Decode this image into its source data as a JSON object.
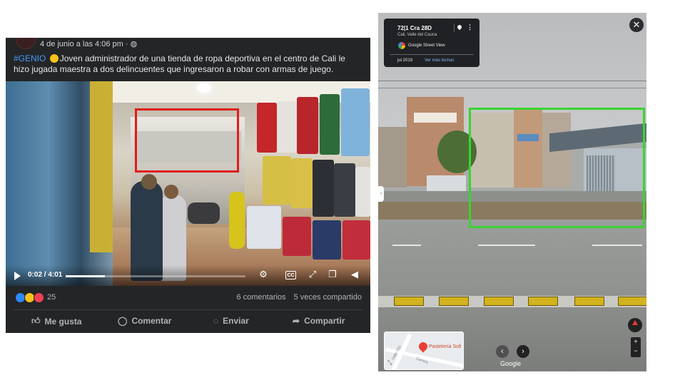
{
  "facebook_post": {
    "date": "4 de junio a las 4:06 pm · ",
    "hashtag": "#GENIO",
    "caption": "Joven administrador de una tienda de ropa deportiva en el centro de Cali le hizo jugada maestra a dos delincuentes que ingresaron a robar con armas de juego.",
    "video": {
      "time": "0:02 / 4:01",
      "progress": 0.22,
      "cc_label": "CC"
    },
    "reaction_count": "25",
    "comments": "6 comentarios",
    "shares": "5 veces compartido",
    "actions": {
      "like": "Me gusta",
      "comment": "Comentar",
      "send": "Enviar",
      "share": "Compartir"
    },
    "highlight_color": "#e11b1b"
  },
  "street_view": {
    "address": "72|1 Cra 28D",
    "city": "Cali, Valle del Cauca",
    "provider": "Google Street View",
    "date": "jul 2019",
    "more_dates": "Ver más fechas",
    "minimap": {
      "place": "Pastelería Sofi",
      "street1": "Calle 72D",
      "street2": "Carrera"
    },
    "watermark": "Google",
    "highlight_color": "#37d52f"
  }
}
